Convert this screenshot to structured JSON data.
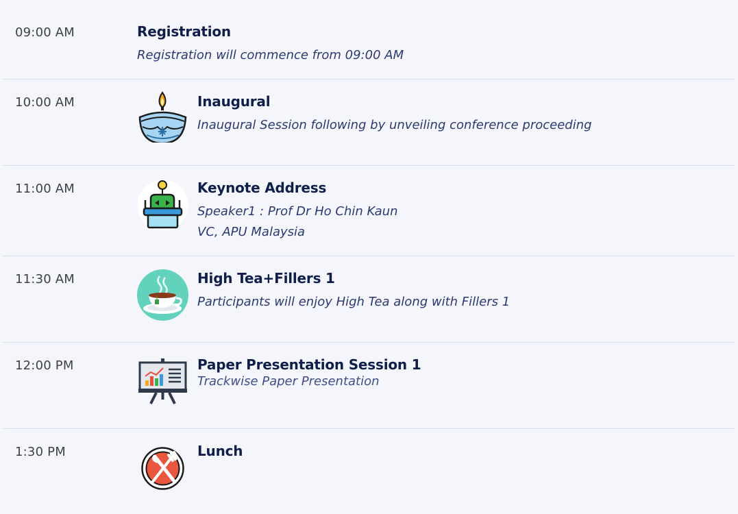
{
  "schedule": {
    "rows": [
      {
        "time": "09:00 AM",
        "title": "Registration",
        "desc": "Registration will commence from 09:00 AM",
        "icon": "none"
      },
      {
        "time": "10:00 AM",
        "title": "Inaugural",
        "desc": "Inaugural Session following by unveiling conference proceeding",
        "icon": "diya-lamp-icon"
      },
      {
        "time": "11:00 AM",
        "title": "Keynote Address",
        "desc_line1": "Speaker1 : Prof Dr Ho Chin Kaun",
        "desc_line2": "VC, APU Malaysia",
        "icon": "speaker-podium-icon"
      },
      {
        "time": "11:30 AM",
        "title": "High Tea+Fillers 1",
        "desc": "Participants will enjoy High Tea along with Fillers 1",
        "icon": "tea-cup-icon"
      },
      {
        "time": "12:00 PM",
        "title": "Paper Presentation Session 1",
        "desc": "Trackwise Paper Presentation",
        "icon": "presentation-board-icon"
      },
      {
        "time": "1:30 PM",
        "title": "Lunch",
        "icon": "plate-cutlery-icon"
      }
    ]
  },
  "colors": {
    "background": "#f5f6fb",
    "title": "#0f1f4a",
    "description": "#2a3a70",
    "time": "#3d4048",
    "divider": "#d9dcea"
  }
}
